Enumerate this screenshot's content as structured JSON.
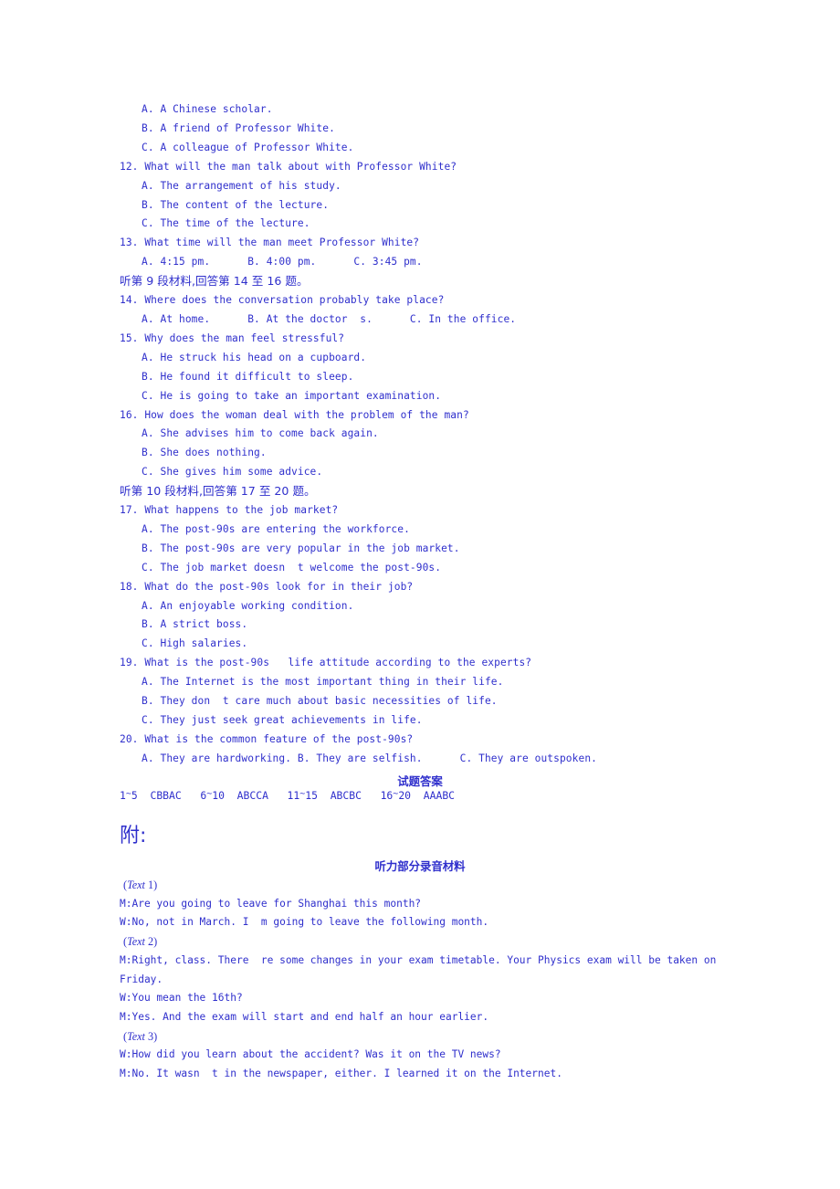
{
  "document": {
    "language": "zh-CN/en",
    "text_color": "#2f2fcc",
    "background_color": "#ffffff"
  },
  "questions_block": {
    "lines": [
      {
        "kind": "option",
        "text": "A. A Chinese scholar."
      },
      {
        "kind": "option",
        "text": "B. A friend of Professor White."
      },
      {
        "kind": "option",
        "text": "C. A colleague of Professor White."
      },
      {
        "kind": "question",
        "text": "12. What will the man talk about with Professor White?"
      },
      {
        "kind": "option",
        "text": "A. The arrangement of his study."
      },
      {
        "kind": "option",
        "text": "B. The content of the lecture."
      },
      {
        "kind": "option",
        "text": "C. The time of the lecture."
      },
      {
        "kind": "question",
        "text": "13. What time will the man meet Professor White?"
      },
      {
        "kind": "option",
        "text": "A. 4:15 pm.      B. 4:00 pm.      C. 3:45 pm."
      },
      {
        "kind": "chinese",
        "text": "听第 9 段材料,回答第 14 至 16 题。"
      },
      {
        "kind": "question",
        "text": "14. Where does the conversation probably take place?"
      },
      {
        "kind": "option",
        "text": "A. At home.      B. At the doctor  s.      C. In the office."
      },
      {
        "kind": "question",
        "text": "15. Why does the man feel stressful?"
      },
      {
        "kind": "option",
        "text": "A. He struck his head on a cupboard."
      },
      {
        "kind": "option",
        "text": "B. He found it difficult to sleep."
      },
      {
        "kind": "option",
        "text": "C. He is going to take an important examination."
      },
      {
        "kind": "question",
        "text": "16. How does the woman deal with the problem of the man?"
      },
      {
        "kind": "option",
        "text": "A. She advises him to come back again."
      },
      {
        "kind": "option",
        "text": "B. She does nothing."
      },
      {
        "kind": "option",
        "text": "C. She gives him some advice."
      },
      {
        "kind": "chinese",
        "text": "听第 10 段材料,回答第 17 至 20 题。"
      },
      {
        "kind": "question",
        "text": "17. What happens to the job market?"
      },
      {
        "kind": "option",
        "text": "A. The post-90s are entering the workforce."
      },
      {
        "kind": "option",
        "text": "B. The post-90s are very popular in the job market."
      },
      {
        "kind": "option",
        "text": "C. The job market doesn  t welcome the post-90s."
      },
      {
        "kind": "question",
        "text": "18. What do the post-90s look for in their job?"
      },
      {
        "kind": "option",
        "text": "A. An enjoyable working condition."
      },
      {
        "kind": "option",
        "text": "B. A strict boss."
      },
      {
        "kind": "option",
        "text": "C. High salaries."
      },
      {
        "kind": "question",
        "text": "19. What is the post-90s   life attitude according to the experts?"
      },
      {
        "kind": "option",
        "text": "A. The Internet is the most important thing in their life."
      },
      {
        "kind": "option",
        "text": "B. They don  t care much about basic necessities of life."
      },
      {
        "kind": "option",
        "text": "C. They just seek great achievements in life."
      },
      {
        "kind": "question",
        "text": "20. What is the common feature of the post-90s?"
      },
      {
        "kind": "option",
        "text": "A. They are hardworking. B. They are selfish.      C. They are outspoken."
      }
    ]
  },
  "answers_section": {
    "heading": "试题答案",
    "groups": [
      {
        "range_start": "1",
        "range_end": "5",
        "answers": "CBBAC"
      },
      {
        "range_start": "6",
        "range_end": "10",
        "answers": "ABCCA"
      },
      {
        "range_start": "11",
        "range_end": "15",
        "answers": "ABCBC"
      },
      {
        "range_start": "16",
        "range_end": "20",
        "answers": "AAABC"
      }
    ]
  },
  "appendix": {
    "label": "附:",
    "script_heading": "听力部分录音材料",
    "script_lines": [
      {
        "kind": "text-label",
        "prefix": "(",
        "italic": "Text",
        "suffix": " 1)"
      },
      {
        "kind": "dialog",
        "text": "M:Are you going to leave for Shanghai this month?"
      },
      {
        "kind": "dialog",
        "text": "W:No, not in March. I  m going to leave the following month."
      },
      {
        "kind": "text-label",
        "prefix": "(",
        "italic": "Text",
        "suffix": " 2)"
      },
      {
        "kind": "dialog",
        "text": "M:Right, class. There  re some changes in your exam timetable. Your Physics exam will be taken on Friday."
      },
      {
        "kind": "dialog",
        "text": "W:You mean the 16th?"
      },
      {
        "kind": "dialog",
        "text": "M:Yes. And the exam will start and end half an hour earlier."
      },
      {
        "kind": "text-label",
        "prefix": "(",
        "italic": "Text",
        "suffix": " 3)"
      },
      {
        "kind": "dialog",
        "text": "W:How did you learn about the accident? Was it on the TV news?"
      },
      {
        "kind": "dialog",
        "text": "M:No. It wasn  t in the newspaper, either. I learned it on the Internet."
      }
    ]
  }
}
